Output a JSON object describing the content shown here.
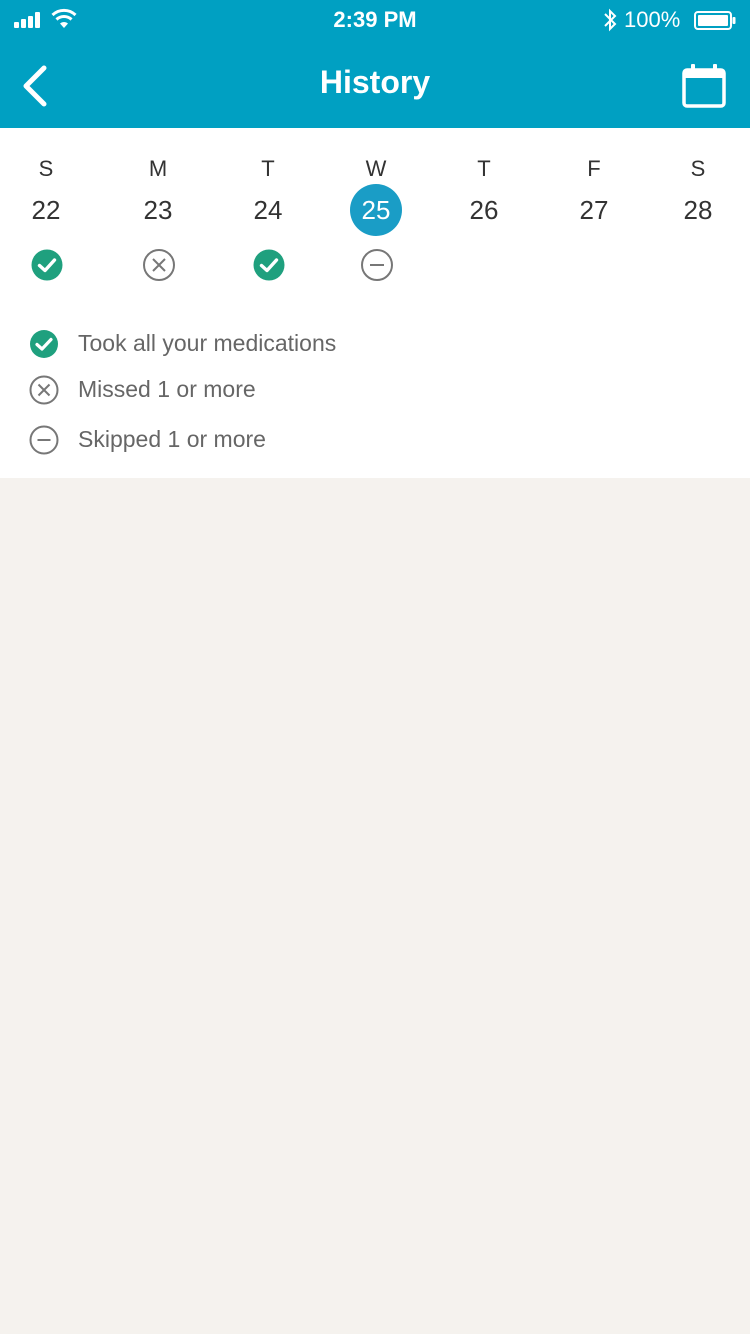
{
  "status_bar": {
    "time": "2:39 PM",
    "battery_percent": "100%",
    "icons": [
      "signal-icon",
      "wifi-icon",
      "bluetooth-icon",
      "battery-icon"
    ]
  },
  "header": {
    "title": "History",
    "back_icon": "chevron-left-icon",
    "calendar_icon": "calendar-icon"
  },
  "week": [
    {
      "dow": "S",
      "date": "22",
      "status": "took"
    },
    {
      "dow": "M",
      "date": "23",
      "status": "missed"
    },
    {
      "dow": "T",
      "date": "24",
      "status": "took"
    },
    {
      "dow": "W",
      "date": "25",
      "status": "skipped",
      "selected": true
    },
    {
      "dow": "T",
      "date": "26",
      "status": null
    },
    {
      "dow": "F",
      "date": "27",
      "status": null
    },
    {
      "dow": "S",
      "date": "28",
      "status": null
    }
  ],
  "legend": {
    "took": "Took all your medications",
    "missed": "Missed 1 or more",
    "skipped": "Skipped 1 or more"
  },
  "colors": {
    "header_bg": "#00a0c2",
    "selected_day": "#1a9dc6",
    "took_green": "#1fa07e",
    "neutral_icon": "#777777",
    "page_bg": "#f5f2ee"
  }
}
